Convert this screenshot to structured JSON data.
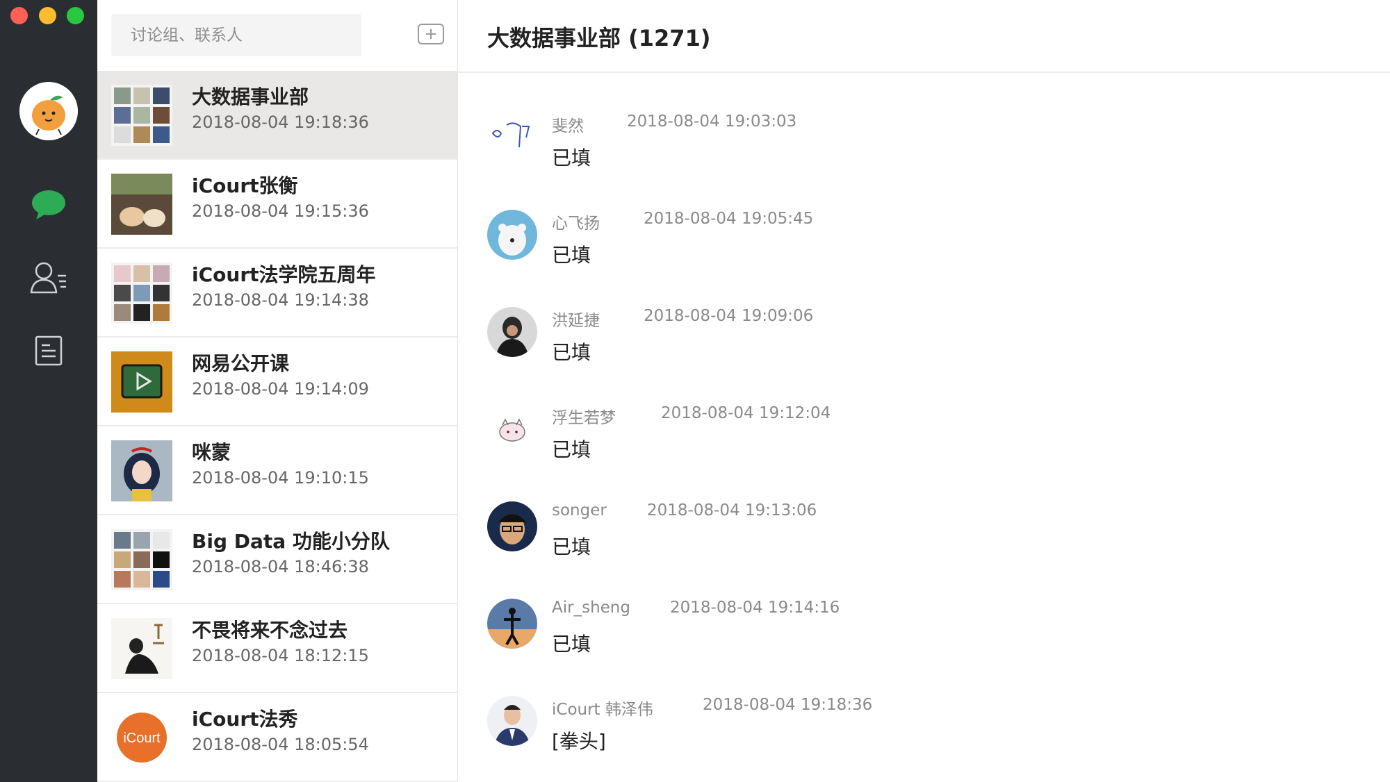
{
  "sidebar": {
    "items": [
      {
        "name": "chat",
        "icon": "chat-bubble-icon",
        "color": "#2dab55"
      },
      {
        "name": "contacts",
        "icon": "contacts-icon"
      },
      {
        "name": "notes",
        "icon": "document-icon"
      }
    ]
  },
  "search": {
    "placeholder": "讨论组、联系人"
  },
  "conversations": [
    {
      "name": "大数据事业部",
      "time": "2018-08-04 19:18:36",
      "selected": true
    },
    {
      "name": "iCourt张衡",
      "time": "2018-08-04 19:15:36"
    },
    {
      "name": "iCourt法学院五周年",
      "time": "2018-08-04 19:14:38"
    },
    {
      "name": "网易公开课",
      "time": "2018-08-04 19:14:09"
    },
    {
      "name": "咪蒙",
      "time": "2018-08-04 19:10:15"
    },
    {
      "name": "Big Data 功能小分队",
      "time": "2018-08-04 18:46:38"
    },
    {
      "name": "不畏将来不念过去",
      "time": "2018-08-04 18:12:15"
    },
    {
      "name": "iCourt法秀",
      "time": "2018-08-04 18:05:54",
      "avatar_text": "iCourt",
      "avatar_color": "#e8702a"
    }
  ],
  "chat": {
    "title": "大数据事业部 (1271)",
    "messages": [
      {
        "sender": "斐然",
        "time": "2018-08-04 19:03:03",
        "text": "已填"
      },
      {
        "sender": "心飞扬",
        "time": "2018-08-04 19:05:45",
        "text": "已填"
      },
      {
        "sender": "洪延捷",
        "time": "2018-08-04 19:09:06",
        "text": "已填"
      },
      {
        "sender": "浮生若梦",
        "time": "2018-08-04 19:12:04",
        "text": "已填"
      },
      {
        "sender": "songer",
        "time": "2018-08-04 19:13:06",
        "text": "已填"
      },
      {
        "sender": "Air_sheng",
        "time": "2018-08-04 19:14:16",
        "text": "已填"
      },
      {
        "sender": "iCourt 韩泽伟",
        "time": "2018-08-04 19:18:36",
        "text": "[拳头]"
      }
    ]
  },
  "colors": {
    "rail_bg": "#2a2d32",
    "selected_row": "#eae8e7",
    "accent_green": "#2dab55"
  }
}
